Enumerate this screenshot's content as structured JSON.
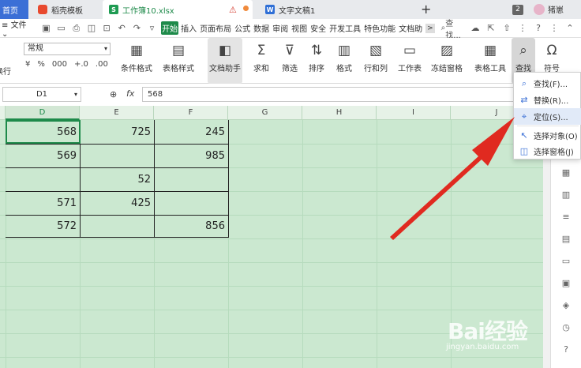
{
  "tabs": {
    "home": "首页",
    "template": "稻壳模板",
    "workbook": "工作簿10.xlsx",
    "doc": "文字文稿1",
    "count": "2",
    "user": "猪崽"
  },
  "menu": {
    "file": "文件",
    "items": [
      "开始",
      "插入",
      "页面布局",
      "公式",
      "数据",
      "审阅",
      "视图",
      "安全",
      "开发工具",
      "特色功能",
      "文档助"
    ],
    "active": "开始",
    "more": ">",
    "search": "查找..."
  },
  "ribbon": {
    "number_format": "常规",
    "wrap": "换行",
    "number_buttons": [
      "¥",
      "%",
      "000",
      "+.0",
      ".00"
    ],
    "buttons": [
      {
        "label": "条件格式",
        "icon": "conditional-format-icon"
      },
      {
        "label": "表格样式",
        "icon": "table-style-icon"
      },
      {
        "label": "文档助手",
        "icon": "doc-assistant-icon"
      },
      {
        "label": "求和",
        "icon": "sum-icon"
      },
      {
        "label": "筛选",
        "icon": "filter-icon"
      },
      {
        "label": "排序",
        "icon": "sort-icon"
      },
      {
        "label": "格式",
        "icon": "format-icon"
      },
      {
        "label": "行和列",
        "icon": "rows-cols-icon"
      },
      {
        "label": "工作表",
        "icon": "worksheet-icon"
      },
      {
        "label": "冻结窗格",
        "icon": "freeze-icon"
      },
      {
        "label": "表格工具",
        "icon": "table-tools-icon"
      },
      {
        "label": "查找",
        "icon": "find-icon"
      },
      {
        "label": "符号",
        "icon": "symbol-icon"
      }
    ]
  },
  "formula_bar": {
    "cell_ref": "D1",
    "fx": "fx",
    "value": "568"
  },
  "columns": [
    "D",
    "E",
    "F",
    "G",
    "H",
    "I",
    "J"
  ],
  "selected_column": "D",
  "table": {
    "rows": [
      [
        "568",
        "725",
        "245"
      ],
      [
        "569",
        "",
        "985"
      ],
      [
        "",
        "52",
        ""
      ],
      [
        "571",
        "425",
        ""
      ],
      [
        "572",
        "",
        "856"
      ]
    ]
  },
  "dropdown": {
    "items": [
      {
        "label": "查找(F)...",
        "icon": "search-icon"
      },
      {
        "label": "替换(R)...",
        "icon": "replace-icon"
      },
      {
        "label": "定位(S)...",
        "icon": "locate-icon"
      },
      {
        "label": "选择对象(O)",
        "icon": "select-object-icon"
      },
      {
        "label": "选择窗格(J)",
        "icon": "selection-pane-icon"
      }
    ],
    "highlighted": "定位(S)..."
  },
  "watermark": {
    "brand": "Bai经验",
    "url": "jingyan.baidu.com"
  },
  "colors": {
    "accent": "#1e8a4a",
    "grid_fill": "#cbe8d0",
    "arrow": "#e02a20",
    "tab_home": "#3b6fd6"
  }
}
